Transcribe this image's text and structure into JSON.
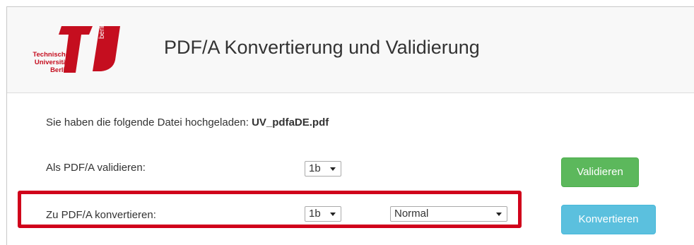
{
  "logo": {
    "name_line1": "Technische",
    "name_line2": "Universität",
    "name_line3": "Berlin",
    "vertical_text": "berlin",
    "brand_color": "#c50e1f"
  },
  "page_title": "PDF/A Konvertierung und Validierung",
  "upload": {
    "prefix": "Sie haben die folgende Datei hochgeladen:",
    "filename": "UV_pdfaDE.pdf"
  },
  "validate_row": {
    "label": "Als PDF/A validieren:",
    "level_value": "1b",
    "button_label": "Validieren",
    "button_color": "#5cb85c"
  },
  "convert_row": {
    "label": "Zu PDF/A konvertieren:",
    "level_value": "1b",
    "mode_value": "Normal",
    "button_label": "Konvertieren",
    "button_color": "#5bc0de"
  },
  "highlight_color": "#d0021b"
}
